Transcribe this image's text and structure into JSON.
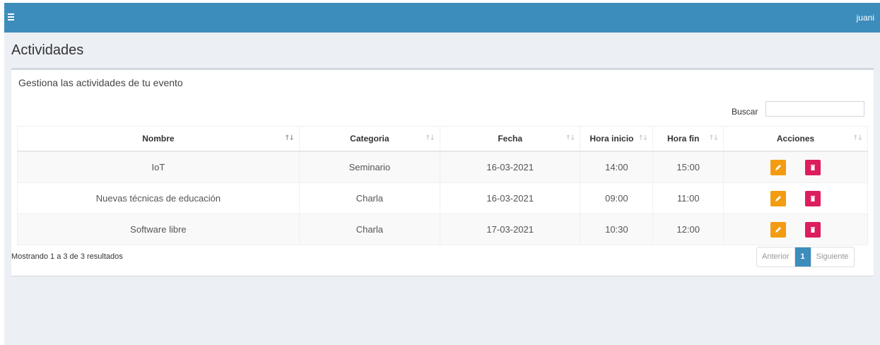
{
  "header": {
    "user": "juani"
  },
  "page": {
    "title": "Actividades",
    "subtitle": "Gestiona las actividades de tu evento"
  },
  "search": {
    "label": "Buscar",
    "value": ""
  },
  "table": {
    "columns": [
      "Nombre",
      "Categoria",
      "Fecha",
      "Hora inicio",
      "Hora fin",
      "Acciones"
    ],
    "rows": [
      {
        "nombre": "IoT",
        "categoria": "Seminario",
        "fecha": "16-03-2021",
        "inicio": "14:00",
        "fin": "15:00"
      },
      {
        "nombre": "Nuevas técnicas de educación",
        "categoria": "Charla",
        "fecha": "16-03-2021",
        "inicio": "09:00",
        "fin": "11:00"
      },
      {
        "nombre": "Software libre",
        "categoria": "Charla",
        "fecha": "17-03-2021",
        "inicio": "10:30",
        "fin": "12:00"
      }
    ]
  },
  "footer": {
    "info": "Mostrando 1 a 3 de 3 resultados",
    "prev": "Anterior",
    "current": "1",
    "next": "Siguiente"
  },
  "colors": {
    "topbar": "#3c8dbc",
    "edit": "#f39c12",
    "delete": "#dd1e5c"
  },
  "icons": {
    "menu": "hamburger-icon",
    "edit": "pencil-icon",
    "delete": "trash-icon",
    "sort": "sort-icon"
  }
}
